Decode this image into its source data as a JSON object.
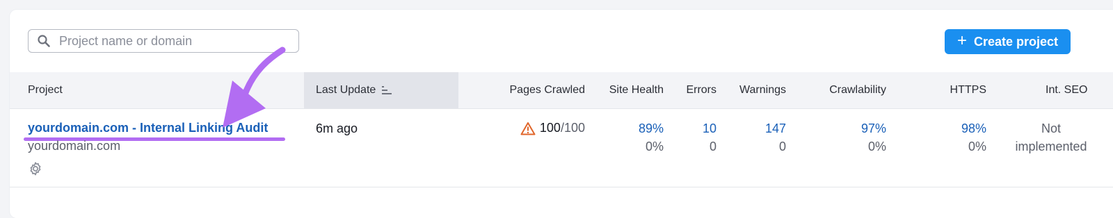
{
  "search": {
    "placeholder": "Project name or domain",
    "value": ""
  },
  "create_button": {
    "label": "Create project"
  },
  "columns": {
    "project": "Project",
    "last_update": "Last Update",
    "pages_crawled": "Pages Crawled",
    "site_health": "Site Health",
    "errors": "Errors",
    "warnings": "Warnings",
    "crawlability": "Crawlability",
    "https": "HTTPS",
    "int_seo": "Int. SEO"
  },
  "row": {
    "title": "yourdomain.com - Internal Linking Audit",
    "domain": "yourdomain.com",
    "last_update": "6m ago",
    "pages_crawled": "100",
    "pages_limit": "/100",
    "site_health": {
      "value": "89%",
      "change": "0%"
    },
    "errors": {
      "value": "10",
      "change": "0"
    },
    "warnings": {
      "value": "147",
      "change": "0"
    },
    "crawlability": {
      "value": "97%",
      "change": "0%"
    },
    "https": {
      "value": "98%",
      "change": "0%"
    },
    "int_seo": {
      "line1": "Not",
      "line2": "implemented"
    }
  },
  "colors": {
    "accent": "#1a8ff0",
    "link": "#1a60b8",
    "annotation": "#b26df2",
    "warning": "#e0662b"
  }
}
